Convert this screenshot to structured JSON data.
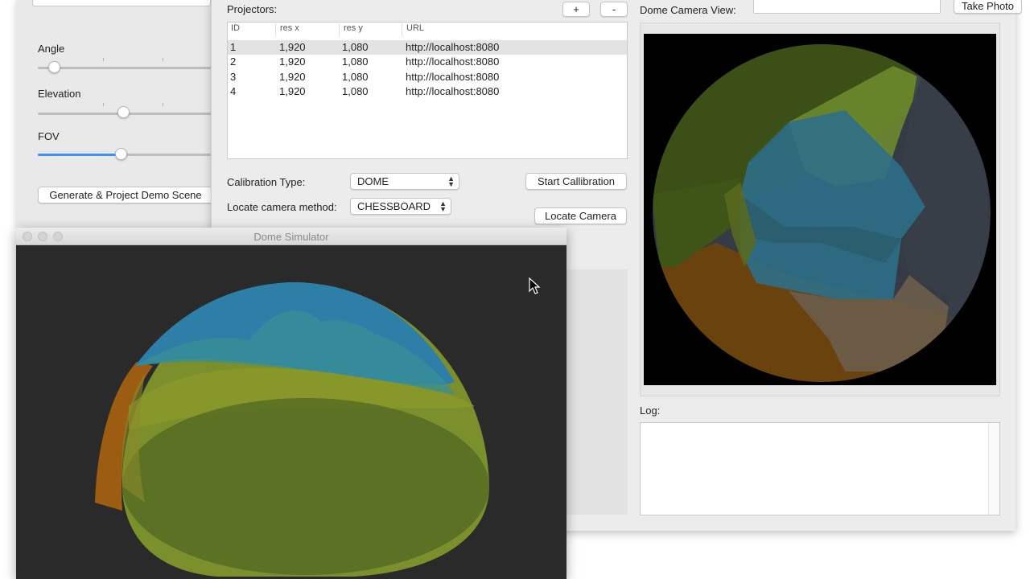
{
  "left_panel": {
    "sliders": [
      {
        "label": "Angle",
        "value": 0.09
      },
      {
        "label": "Elevation",
        "value": 0.49
      },
      {
        "label": "FOV",
        "value": 0.48
      }
    ],
    "generate_button": "Generate & Project Demo Scene"
  },
  "projectors": {
    "label": "Projectors:",
    "add_button": "+",
    "remove_button": "-",
    "columns": [
      "ID",
      "res x",
      "res y",
      "URL"
    ],
    "rows": [
      {
        "id": "1",
        "res_x": "1,920",
        "res_y": "1,080",
        "url": "http://localhost:8080"
      },
      {
        "id": "2",
        "res_x": "1,920",
        "res_y": "1,080",
        "url": "http://localhost:8080"
      },
      {
        "id": "3",
        "res_x": "1,920",
        "res_y": "1,080",
        "url": "http://localhost:8080"
      },
      {
        "id": "4",
        "res_x": "1,920",
        "res_y": "1,080",
        "url": "http://localhost:8080"
      }
    ],
    "selected_row": 0
  },
  "calibration": {
    "type_label": "Calibration Type:",
    "type_value": "DOME",
    "locate_label": "Locate camera method:",
    "locate_value": "CHESSBOARD",
    "start_button": "Start Callibration",
    "locate_button": "Locate Camera"
  },
  "camera": {
    "label": "Dome Camera View:",
    "field_value": "",
    "take_photo_button": "Take Photo"
  },
  "log": {
    "label": "Log:",
    "content": ""
  },
  "simulator": {
    "title": "Dome Simulator"
  },
  "colors": {
    "accent": "#3b8fff",
    "projector_green": "#7a9a2a",
    "projector_blue": "#2f8fbf",
    "projector_orange": "#c06a10",
    "projector_grey": "#5c6370"
  }
}
